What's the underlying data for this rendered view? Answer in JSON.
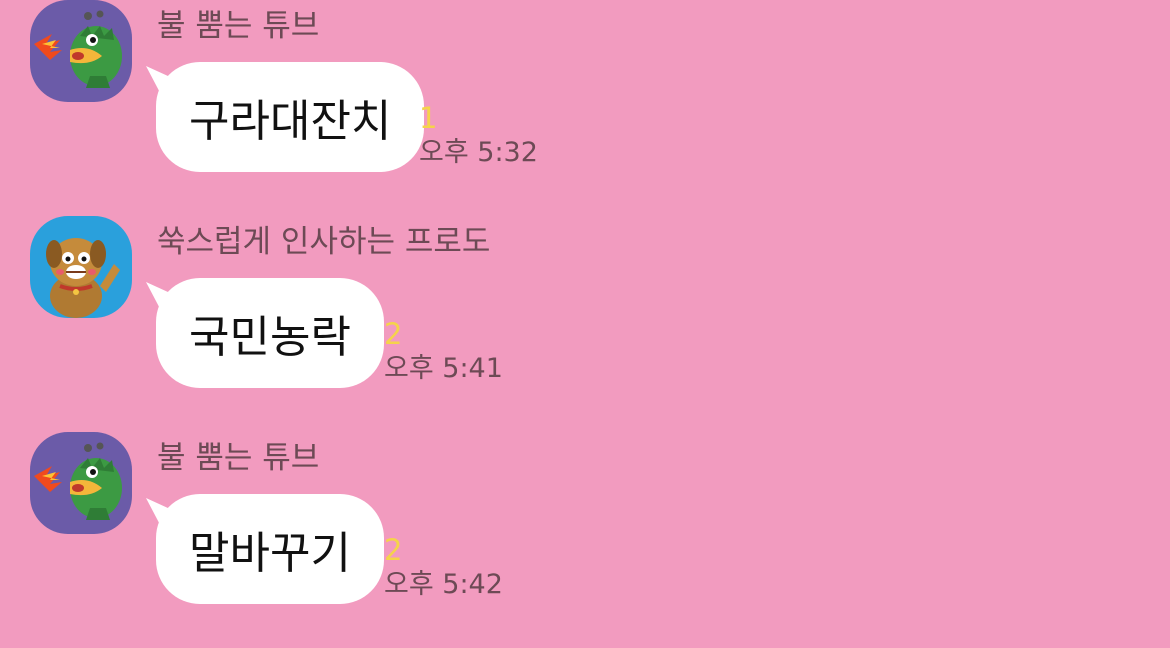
{
  "messages": [
    {
      "sender": "불 뿜는 튜브",
      "avatar_icon": "fire-breathing-tube-avatar",
      "text": "구라대잔치",
      "unread": "1",
      "time": "오후 5:32"
    },
    {
      "sender": "쑥스럽게 인사하는 프로도",
      "avatar_icon": "waving-frodo-avatar",
      "text": "국민농락",
      "unread": "2",
      "time": "오후 5:41"
    },
    {
      "sender": "불 뿜는 튜브",
      "avatar_icon": "fire-breathing-tube-avatar",
      "text": "말바꾸기",
      "unread": "2",
      "time": "오후 5:42"
    }
  ],
  "colors": {
    "background": "#f29bbf",
    "bubble": "#ffffff",
    "unread_count": "#f5d34a",
    "meta_text": "#6d4a55"
  }
}
